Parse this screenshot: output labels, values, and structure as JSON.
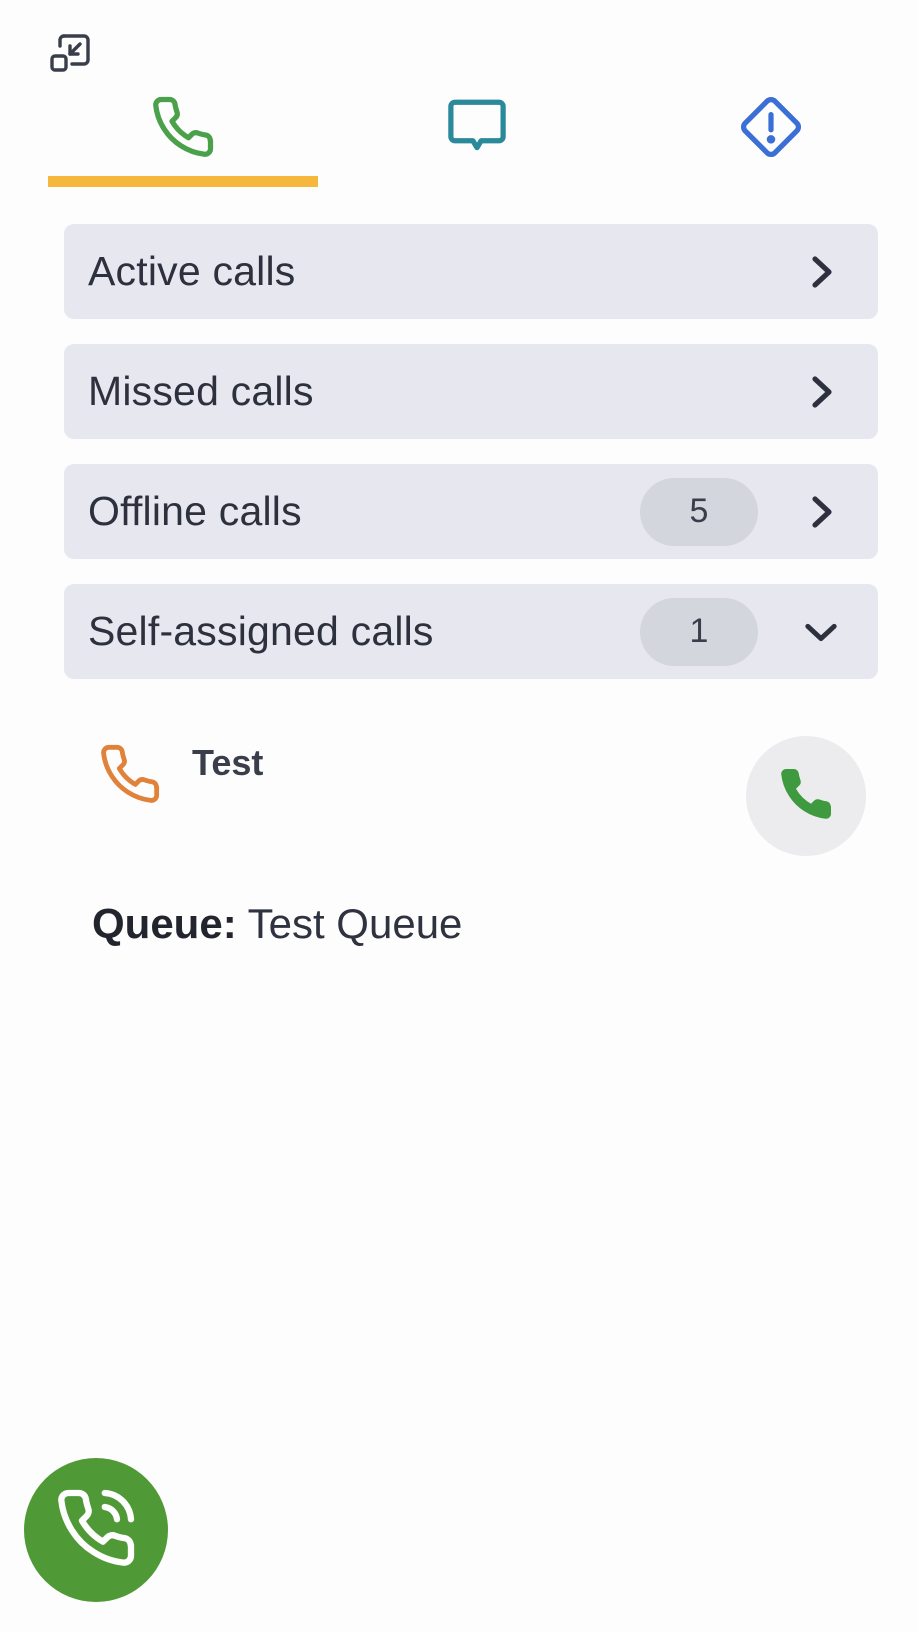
{
  "icons": {
    "minimize": "minimize-icon",
    "tab_calls": "phone-icon",
    "tab_chat": "chat-bubble-icon",
    "tab_alerts": "alert-diamond-icon",
    "chevron_right": "chevron-right-icon",
    "chevron_down": "chevron-down-icon",
    "incoming_call": "phone-icon",
    "answer": "phone-icon",
    "softphone": "phone-ringing-icon"
  },
  "colors": {
    "active_tab_underline": "#f5b73c",
    "calls_tab_icon": "#4aa14a",
    "chat_tab_icon": "#2a8a9a",
    "alerts_tab_icon": "#3b6fd6",
    "row_background": "#e6e7ef",
    "badge_background": "#d4d6de",
    "incoming_call_icon": "#e0823a",
    "answer_icon": "#3f9a3f",
    "fab_background": "#4f9a37"
  },
  "call_groups": [
    {
      "label": "Active calls",
      "badge": null,
      "expanded": false
    },
    {
      "label": "Missed calls",
      "badge": null,
      "expanded": false
    },
    {
      "label": "Offline calls",
      "badge": "5",
      "expanded": false
    },
    {
      "label": "Self-assigned calls",
      "badge": "1",
      "expanded": true
    }
  ],
  "self_assigned_call": {
    "name": "Test",
    "queue_label": "Queue:",
    "queue_value": "Test Queue"
  }
}
